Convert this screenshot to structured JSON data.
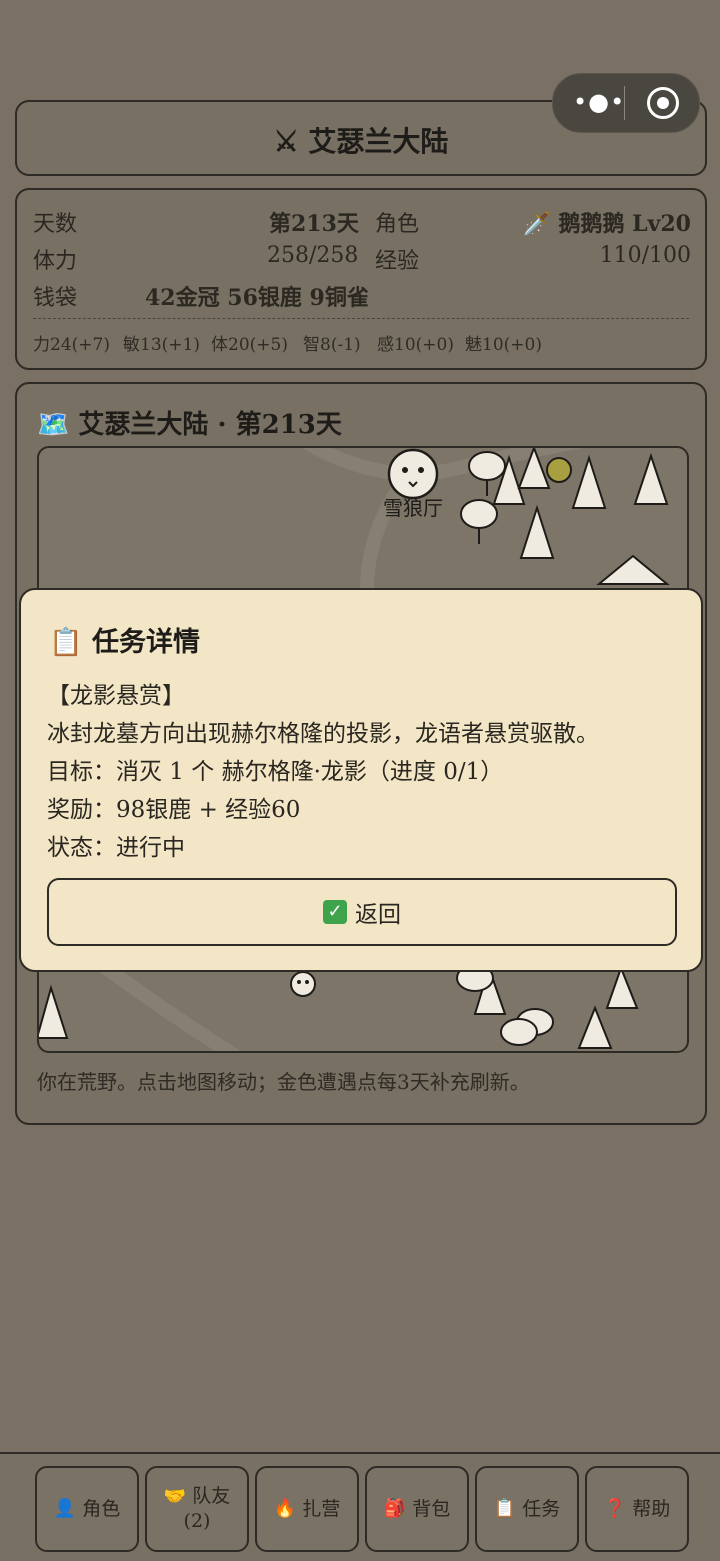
{
  "header": {
    "title": "⚔ 艾瑟兰大陆"
  },
  "stats": {
    "days_label": "天数",
    "days_value": "第213天",
    "role_label": "角色",
    "role_value": "🗡️ 鹅鹅鹅 Lv20",
    "stamina_label": "体力",
    "stamina_value": "258/258",
    "exp_label": "经验",
    "exp_value": "110/100",
    "purse_label": "钱袋",
    "purse_value": "42金冠 56银鹿 9铜雀",
    "attributes": [
      "力24(+7)",
      "敏13(+1)",
      "体20(+5)",
      "智8(-1)",
      "感10(+0)",
      "魅10(+0)"
    ]
  },
  "map": {
    "title": "🗺️ 艾瑟兰大陆 · 第213天",
    "location_label": "雪狼厅",
    "hint": "你在荒野。点击地图移动；金色遭遇点每3天补充刷新。"
  },
  "modal": {
    "title": "📋 任务详情",
    "quest_name": "【龙影悬赏】",
    "description": "冰封龙墓方向出现赫尔格隆的投影，龙语者悬赏驱散。",
    "objective": "目标：消灭 1 个 赫尔格隆·龙影（进度 0/1）",
    "reward": "奖励：98银鹿 + 经验60",
    "status": "状态：进行中",
    "back_label": "返回"
  },
  "bottom_nav": {
    "role": "角色",
    "team": "队友",
    "team_count": "(2)",
    "camp": "扎营",
    "bag": "背包",
    "quest": "任务",
    "help": "帮助"
  },
  "colors": {
    "modal_bg": "#f3e6c7",
    "overlay": "#7a7164",
    "confirm_green": "#3ea34a"
  }
}
